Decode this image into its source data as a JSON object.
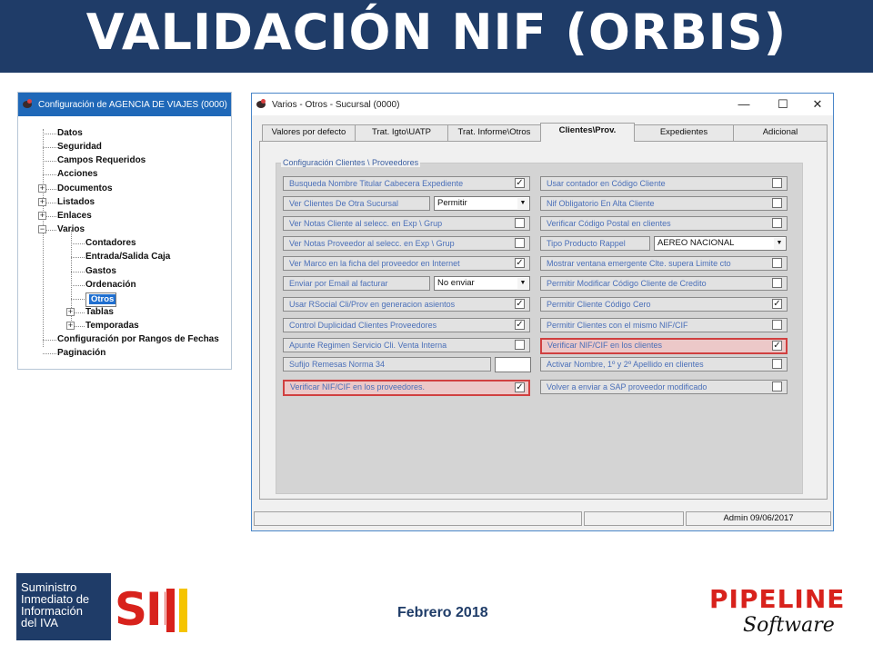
{
  "slide_title": "VALIDACIÓN NIF (ORBIS)",
  "tree_window": {
    "title": "Configuración de AGENCIA DE VIAJES (0000)",
    "items": [
      {
        "label": "Datos",
        "expander": ""
      },
      {
        "label": "Seguridad",
        "expander": ""
      },
      {
        "label": "Campos Requeridos",
        "expander": ""
      },
      {
        "label": "Acciones",
        "expander": ""
      },
      {
        "label": "Documentos",
        "expander": "+"
      },
      {
        "label": "Listados",
        "expander": "+"
      },
      {
        "label": "Enlaces",
        "expander": "+"
      },
      {
        "label": "Varios",
        "expander": "−"
      },
      {
        "label": "Contadores",
        "expander": ""
      },
      {
        "label": "Entrada/Salida Caja",
        "expander": ""
      },
      {
        "label": "Gastos",
        "expander": ""
      },
      {
        "label": "Ordenación",
        "expander": ""
      },
      {
        "label": "Otros",
        "expander": "",
        "selected": true
      },
      {
        "label": "Tablas",
        "expander": "+"
      },
      {
        "label": "Temporadas",
        "expander": "+"
      },
      {
        "label": "Configuración por Rangos de Fechas",
        "expander": ""
      },
      {
        "label": "Paginación",
        "expander": ""
      }
    ]
  },
  "dialog": {
    "title": "Varios - Otros - Sucursal (0000)",
    "tabs": [
      "Valores por defecto",
      "Trat. Igto\\UATP",
      "Trat. Informe\\Otros",
      "Clientes\\Prov.",
      "Expedientes",
      "Adicional"
    ],
    "active_tab": "Clientes\\Prov.",
    "group_title": "Configuración Clientes \\ Proveedores",
    "left_rows": [
      {
        "label": "Busqueda Nombre Titular Cabecera Expediente",
        "checked": "✓"
      },
      {
        "label": "Ver Clientes  De Otra Sucursal",
        "select": "Permitir"
      },
      {
        "label": "Ver Notas Cliente al selecc. en Exp \\ Grup",
        "checked": ""
      },
      {
        "label": "Ver Notas Proveedor al selecc. en Exp \\ Grup",
        "checked": ""
      },
      {
        "label": "Ver Marco en la ficha del proveedor en Internet",
        "checked": "✓"
      },
      {
        "label": "Enviar por Email al facturar",
        "select": "No enviar"
      },
      {
        "label": "Usar RSocial Cli/Prov en generacion asientos",
        "checked": "✓"
      },
      {
        "label": "Control Duplicidad Clientes Proveedores",
        "checked": "✓"
      },
      {
        "label": "Apunte Regimen Servicio Cli. Venta Interna",
        "checked": ""
      },
      {
        "label": "Sufijo Remesas Norma 34",
        "input": ""
      },
      {
        "label": "Verificar NIF/CIF en los proveedores.",
        "checked": "✓",
        "highlight": true
      }
    ],
    "right_rows": [
      {
        "label": "Usar contador en Código Cliente",
        "checked": ""
      },
      {
        "label": "Nif Obligatorio En Alta Cliente",
        "checked": ""
      },
      {
        "label": "Verificar Código Postal en clientes",
        "checked": ""
      },
      {
        "label": "Tipo Producto Rappel",
        "select": "AEREO NACIONAL"
      },
      {
        "label": "Mostrar ventana emergente Clte. supera Limite cto",
        "checked": ""
      },
      {
        "label": "Permitir Modificar Código Cliente de Credito",
        "checked": ""
      },
      {
        "label": "Permitir Cliente Código Cero",
        "checked": "✓"
      },
      {
        "label": "Permitir Clientes con el mismo NIF/CIF",
        "checked": ""
      },
      {
        "label": "Verificar NIF/CIF en los clientes",
        "checked": "✓",
        "highlight": true
      },
      {
        "label": "Activar  Nombre, 1º y 2º Apellido en clientes",
        "checked": ""
      },
      {
        "label": "Volver a enviar a SAP proveedor modificado",
        "checked": ""
      }
    ],
    "status": {
      "user_date": "Admin 09/06/2017"
    },
    "window_buttons": {
      "minimize": "—",
      "maximize": "☐",
      "close": "✕"
    }
  },
  "footer": {
    "sii_text": [
      "Suministro",
      "Inmediato de",
      "Información",
      "del IVA"
    ],
    "sii_logo": "SII",
    "sii_colors": [
      "#d8221c",
      "#f5c400"
    ],
    "date": "Febrero 2018",
    "brand": "PIPELINE",
    "brand_sub": "Software"
  }
}
